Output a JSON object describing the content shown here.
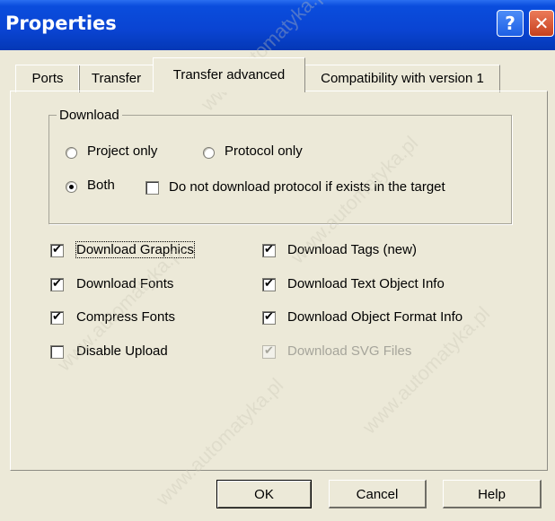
{
  "window": {
    "title": "Properties",
    "help_glyph": "?",
    "close_glyph": "✕"
  },
  "tabs": [
    {
      "label": "Ports",
      "active": false
    },
    {
      "label": "Transfer",
      "active": false
    },
    {
      "label": "Transfer advanced",
      "active": true
    },
    {
      "label": "Compatibility with version 1",
      "active": false
    }
  ],
  "download_group": {
    "title": "Download",
    "radios": [
      {
        "label": "Project only",
        "checked": false
      },
      {
        "label": "Protocol only",
        "checked": false
      },
      {
        "label": "Both",
        "checked": true
      }
    ],
    "protocol_checkbox": {
      "label": "Do not download protocol if exists in the target",
      "checked": false
    }
  },
  "options_left": [
    {
      "label": "Download Graphics",
      "checked": true
    },
    {
      "label": "Download Fonts",
      "checked": true
    },
    {
      "label": "Compress Fonts",
      "checked": true
    },
    {
      "label": "Disable Upload",
      "checked": false
    }
  ],
  "options_right": [
    {
      "label": "Download Tags (new)",
      "checked": true
    },
    {
      "label": "Download Text Object  Info",
      "checked": true
    },
    {
      "label": "Download Object Format Info",
      "checked": true
    },
    {
      "label": "Download SVG Files",
      "checked": true,
      "disabled": true
    }
  ],
  "check_glyph": "✔",
  "buttons": {
    "ok": "OK",
    "cancel": "Cancel",
    "help": "Help"
  },
  "watermark": "www.automatyka.pl"
}
